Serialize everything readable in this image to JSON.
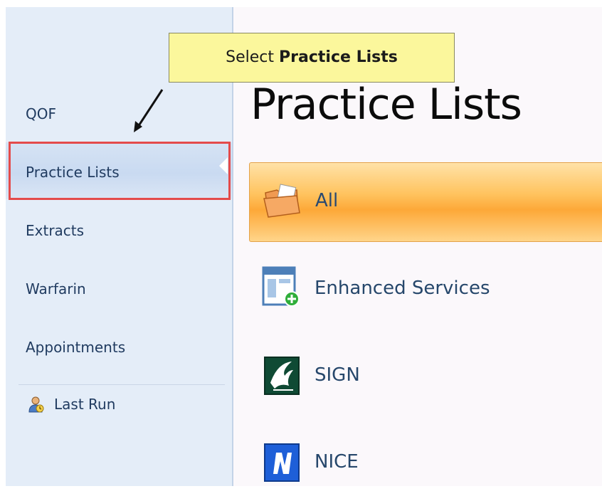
{
  "tooltip": {
    "prefix": "Select ",
    "emphasis": "Practice Lists"
  },
  "sidebar": {
    "items": [
      {
        "label": "QOF"
      },
      {
        "label": "Practice Lists"
      },
      {
        "label": "Extracts"
      },
      {
        "label": "Warfarin"
      },
      {
        "label": "Appointments"
      }
    ],
    "last_run": {
      "label": "Last Run",
      "icon": "last-run-icon"
    }
  },
  "main": {
    "title": "Practice Lists",
    "items": [
      {
        "label": "All",
        "icon": "folder-icon",
        "selected": true
      },
      {
        "label": "Enhanced Services",
        "icon": "enhanced-services-icon"
      },
      {
        "label": "SIGN",
        "icon": "sign-icon"
      },
      {
        "label": "NICE",
        "icon": "nice-icon"
      }
    ]
  },
  "colors": {
    "sidebar_bg": "#e4edf8",
    "selected_item": "#fda838",
    "highlight_border": "#e44b4b",
    "tooltip_bg": "#fbf79c",
    "label_text": "#26476b"
  }
}
